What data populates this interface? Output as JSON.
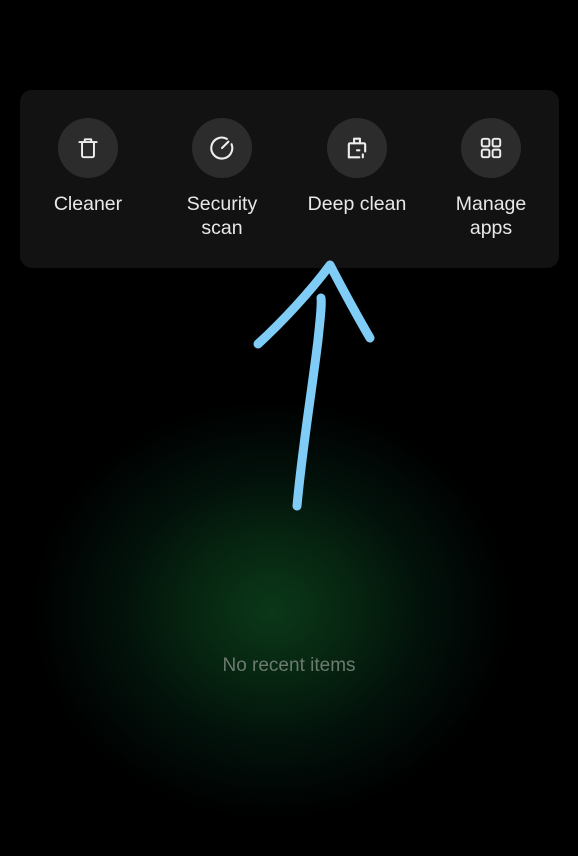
{
  "quick_actions": {
    "items": [
      {
        "icon": "trash-icon",
        "label": "Cleaner"
      },
      {
        "icon": "gauge-icon",
        "label": "Security scan"
      },
      {
        "icon": "broom-icon",
        "label": "Deep clean"
      },
      {
        "icon": "grid-icon",
        "label": "Manage apps"
      }
    ]
  },
  "recents": {
    "empty_text": "No recent items"
  },
  "annotation": {
    "color": "#7fcdf6",
    "icon": "hand-drawn-arrow-up"
  }
}
